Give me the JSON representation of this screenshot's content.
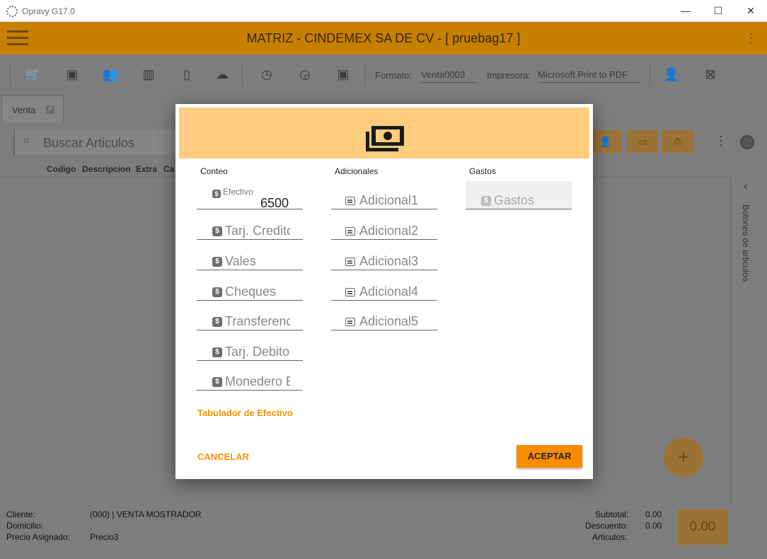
{
  "window": {
    "title": "Opravy G17.0",
    "minimize": "—",
    "maximize": "☐",
    "close": "✕"
  },
  "header": {
    "title": "MATRIZ - CINDEMEX SA DE CV - [ pruebag17 ]"
  },
  "toolbar": {
    "formato_label": "Formato:",
    "formato_value": "Venta0003",
    "impresora_label": "Impresora:",
    "impresora_value": "Microsoft Print to PDF"
  },
  "tabs": [
    {
      "label": "Venta",
      "close": "✕"
    }
  ],
  "search": {
    "placeholder": "Buscar Articulos"
  },
  "columns": [
    "Codigo",
    "Descripcion",
    "Extra",
    "Ca"
  ],
  "side_panel": {
    "label": "Botones de articulos"
  },
  "footer": {
    "cliente_label": "Cliente:",
    "cliente_value": "(000) | VENTA MOSTRADOR",
    "domicilio_label": "Domicilio:",
    "domicilio_value": ".",
    "precio_label": "Precio Asignado:",
    "precio_value": "Precio3",
    "subtotal_label": "Subtotal:",
    "subtotal_value": "0.00",
    "descuento_label": "Descuento:",
    "descuento_value": "0.00",
    "articulos_label": "Articulos:",
    "total": "0.00"
  },
  "modal": {
    "conteo_title": "Conteo",
    "adicionales_title": "Adicionales",
    "gastos_title": "Gastos",
    "efectivo_label": "Efectivo",
    "efectivo_value": "6500",
    "conteo_fields": [
      "Tarj. Credito",
      "Vales",
      "Cheques",
      "Transferencia",
      "Tarj. Debito",
      "Monedero Electronico"
    ],
    "adicionales_fields": [
      "Adicional1",
      "Adicional2",
      "Adicional3",
      "Adicional4",
      "Adicional5"
    ],
    "gastos_placeholder": "Gastos",
    "tabulador_link": "Tabulador de Efectivo",
    "cancel_label": "CANCELAR",
    "accept_label": "ACEPTAR"
  },
  "colors": {
    "accent": "#fb8c00",
    "modal_header": "#ffcc80",
    "app_header": "#d88a00"
  }
}
